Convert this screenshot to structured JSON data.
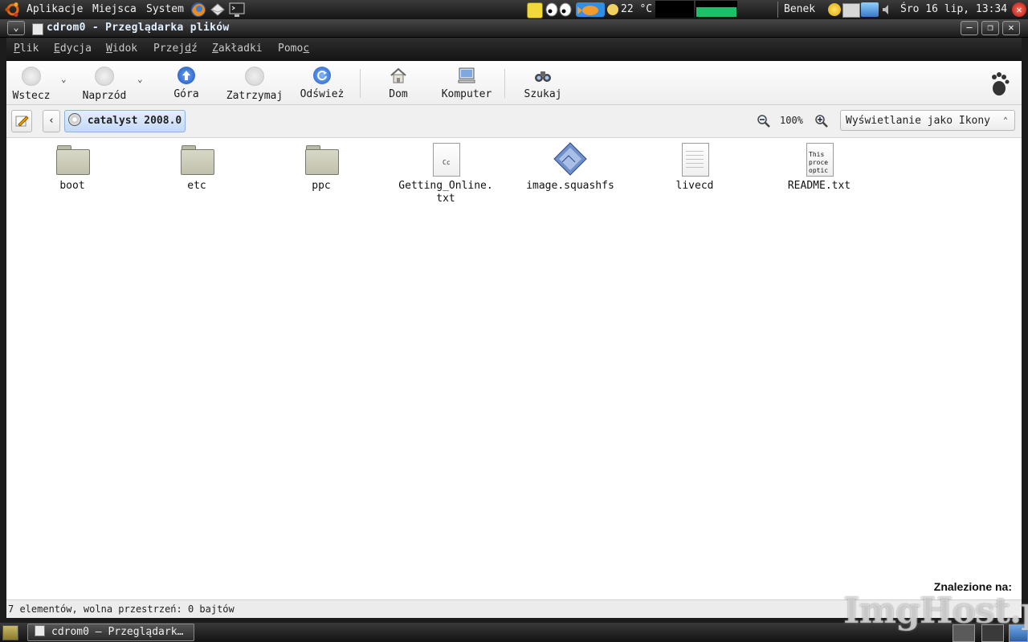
{
  "top_panel": {
    "menus": [
      "Aplikacje",
      "Miejsca",
      "System"
    ],
    "weather": "22 °C",
    "user": "Benek",
    "clock": "Śro 16 lip, 13:34"
  },
  "window": {
    "title": "cdrom0 - Przeglądarka plików"
  },
  "menubar": {
    "items": [
      {
        "pre": "",
        "key": "P",
        "post": "lik"
      },
      {
        "pre": "",
        "key": "E",
        "post": "dycja"
      },
      {
        "pre": "",
        "key": "W",
        "post": "idok"
      },
      {
        "pre": "Przej",
        "key": "d",
        "post": "ź"
      },
      {
        "pre": "",
        "key": "Z",
        "post": "akładki"
      },
      {
        "pre": "Pomo",
        "key": "c",
        "post": ""
      }
    ]
  },
  "toolbar": {
    "back": "Wstecz",
    "forward": "Naprzód",
    "up": "Góra",
    "stop": "Zatrzymaj",
    "reload": "Odśwież",
    "home": "Dom",
    "computer": "Komputer",
    "search": "Szukaj"
  },
  "location": {
    "path_button": "catalyst 2008.0",
    "back_arrow": "‹",
    "zoom": "100%",
    "view_mode": "Wyświetlanie jako Ikony"
  },
  "files": [
    {
      "name": "boot",
      "type": "folder"
    },
    {
      "name": "etc",
      "type": "folder"
    },
    {
      "name": "ppc",
      "type": "folder"
    },
    {
      "name": "Getting_Online.txt",
      "type": "text"
    },
    {
      "name": "image.squashfs",
      "type": "image"
    },
    {
      "name": "livecd",
      "type": "blank"
    },
    {
      "name": "README.txt",
      "type": "text-preview"
    }
  ],
  "file_icon_text": {
    "getting_online": "Cc",
    "readme_preview": [
      "This",
      "proce",
      "optic"
    ]
  },
  "search_label": "Znalezione na:",
  "statusbar": {
    "text": "7 elementów, wolna przestrzeń: 0 bajtów"
  },
  "taskbar": {
    "task": "cdrom0 – Przeglądark…"
  },
  "watermark": "ImgHost.pl"
}
